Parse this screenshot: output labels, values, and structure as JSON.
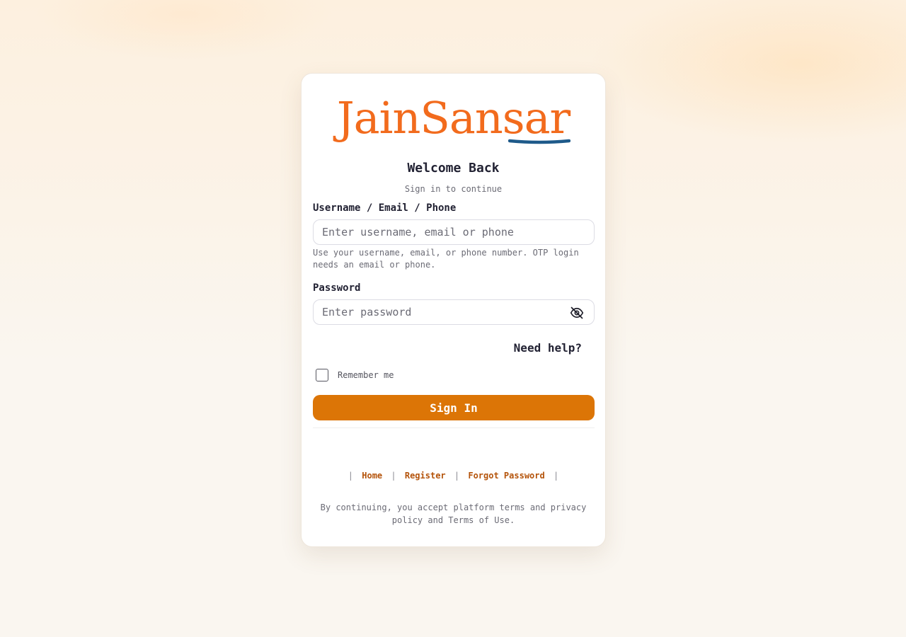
{
  "brand": {
    "name": "JainSansar",
    "color": "#f26b1d",
    "swoosh_color": "#1e5a8a"
  },
  "header": {
    "title": "Welcome Back",
    "subtitle": "Sign in to continue"
  },
  "login": {
    "identifier_label": "Username / Email / Phone",
    "identifier_placeholder": "Enter username, email or phone",
    "identifier_value": "",
    "identifier_hint": "Use your username, email, or phone number. OTP login needs an email or phone.",
    "password_label": "Password",
    "password_placeholder": "Enter password",
    "password_value": "",
    "password_toggle_icon": "eye-off-icon",
    "help_label": "Need help?",
    "remember_label": "Remember me",
    "remember_checked": false,
    "submit_label": "Sign In",
    "accent_color": "#dc7506"
  },
  "footer": {
    "separator": "|",
    "links": [
      "Home",
      "Register",
      "Forgot Password"
    ],
    "link_color": "#b4530a",
    "terms": "By continuing, you accept platform terms and privacy policy and Terms of Use."
  }
}
